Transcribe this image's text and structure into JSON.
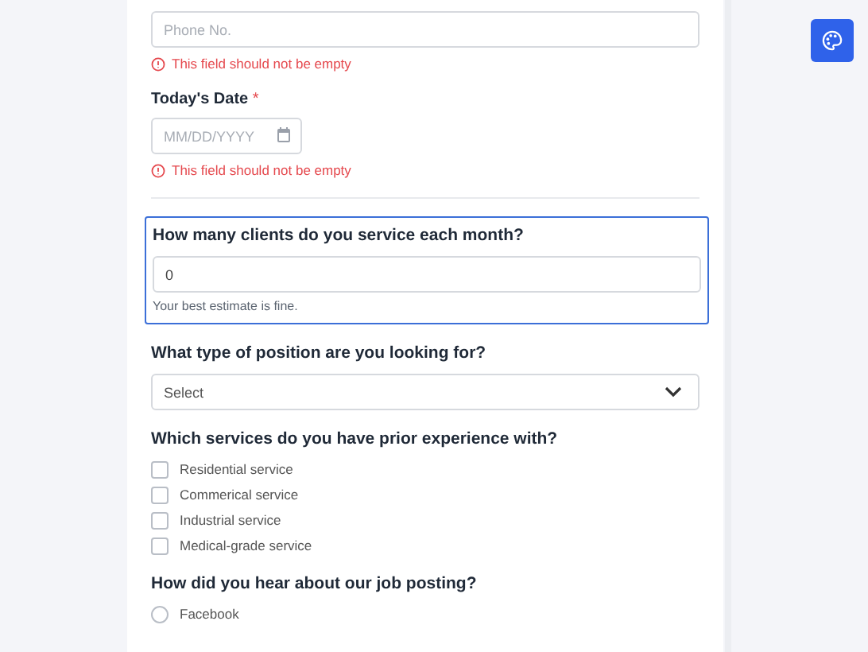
{
  "phone_field": {
    "placeholder": "Phone No.",
    "error": "This field should not be empty"
  },
  "date_field": {
    "label": "Today's Date",
    "required_mark": "*",
    "placeholder": "MM/DD/YYYY",
    "error": "This field should not be empty"
  },
  "clients_question": {
    "label": "How many clients do you service each month?",
    "value": "0",
    "hint": "Your best estimate is fine.",
    "focused": true
  },
  "position_question": {
    "label": "What type of position are you looking for?",
    "placeholder": "Select"
  },
  "services_question": {
    "label": "Which services do you have prior experience with?",
    "options": [
      {
        "label": "Residential service",
        "checked": false
      },
      {
        "label": "Commerical service",
        "checked": false
      },
      {
        "label": "Industrial service",
        "checked": false
      },
      {
        "label": "Medical-grade service",
        "checked": false
      }
    ]
  },
  "source_question": {
    "label": "How did you hear about our job posting?",
    "options": [
      {
        "label": "Facebook",
        "selected": false
      }
    ]
  }
}
